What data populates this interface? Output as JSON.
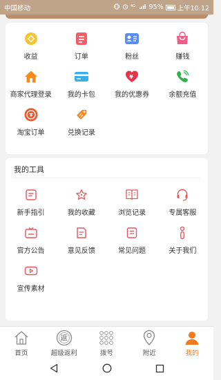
{
  "status": {
    "carrier": "中国移动",
    "battery": "95%",
    "time": "上午10:12"
  },
  "services": [
    {
      "label": "收益",
      "icon": "coin-icon"
    },
    {
      "label": "订单",
      "icon": "order-icon"
    },
    {
      "label": "粉丝",
      "icon": "fans-icon"
    },
    {
      "label": "赚钱",
      "icon": "bag-icon"
    },
    {
      "label": "商家代理登录",
      "icon": "house-icon"
    },
    {
      "label": "我的卡包",
      "icon": "card-icon"
    },
    {
      "label": "我的优惠券",
      "icon": "heart-coupon-icon"
    },
    {
      "label": "余额充值",
      "icon": "phone-icon"
    },
    {
      "label": "淘宝订单",
      "icon": "taobao-icon"
    },
    {
      "label": "兑换记录",
      "icon": "exchange-icon"
    }
  ],
  "tools": {
    "title": "我的工具",
    "items": [
      {
        "label": "新手指引",
        "icon": "guide-icon"
      },
      {
        "label": "我的收藏",
        "icon": "star-icon"
      },
      {
        "label": "浏览记录",
        "icon": "book-icon"
      },
      {
        "label": "专属客服",
        "icon": "headset-icon"
      },
      {
        "label": "官方公告",
        "icon": "tv-icon"
      },
      {
        "label": "意见反馈",
        "icon": "feedback-icon"
      },
      {
        "label": "常见问题",
        "icon": "faq-icon"
      },
      {
        "label": "关于我们",
        "icon": "info-icon"
      },
      {
        "label": "宣传素材",
        "icon": "video-icon"
      }
    ]
  },
  "tabs": [
    {
      "label": "首页",
      "icon": "home-icon"
    },
    {
      "label": "超级返利",
      "icon": "rebate-icon",
      "icon_text": "返"
    },
    {
      "label": "拨号",
      "icon": "dialpad-icon"
    },
    {
      "label": "附近",
      "icon": "location-icon"
    },
    {
      "label": "我的",
      "icon": "user-icon",
      "active": true
    }
  ],
  "colors": {
    "accent": "#f07b1d",
    "tool_red": "#e8555a"
  }
}
